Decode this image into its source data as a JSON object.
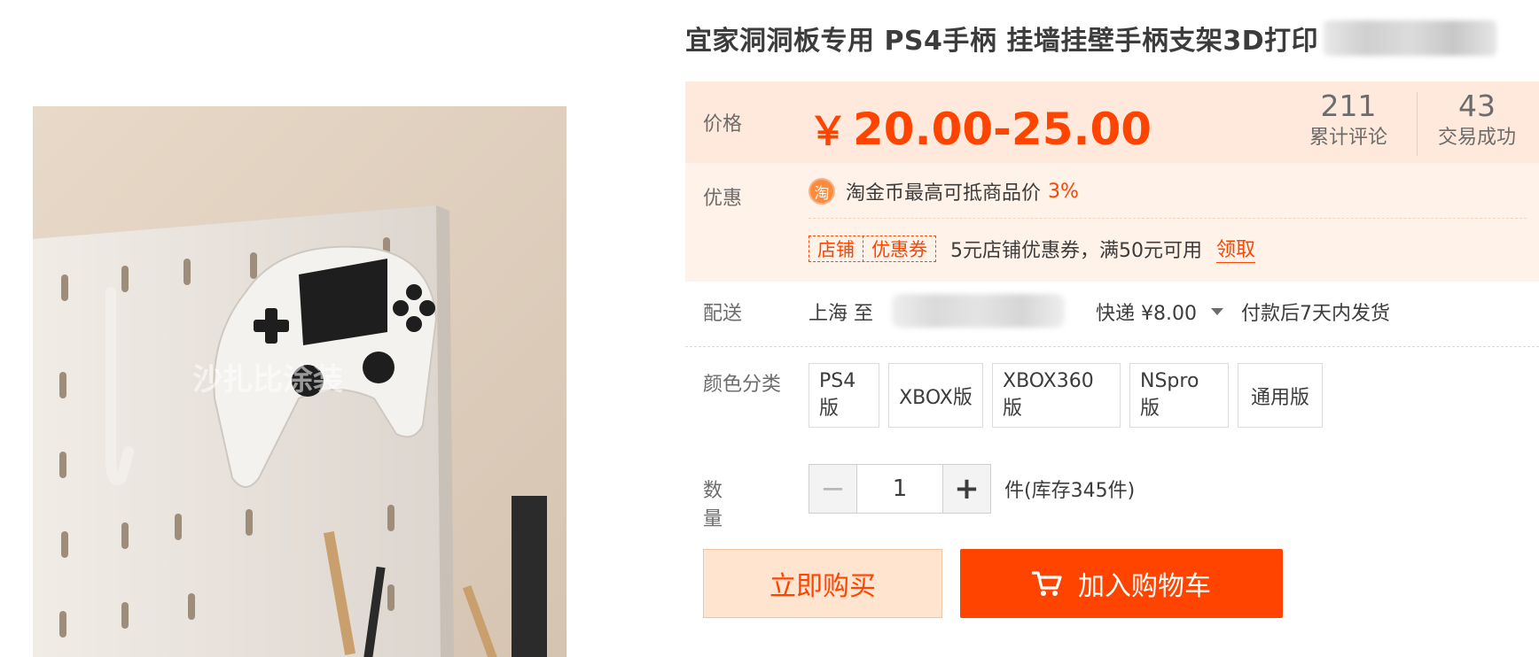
{
  "colors": {
    "accent": "#ff4400",
    "promo_bg": "#fff2e8",
    "price_bg": "#ffe9dc"
  },
  "product": {
    "title": "宜家洞洞板专用 PS4手柄 挂墙挂壁手柄支架3D打印",
    "image_alt": "PS4 controller mounted on pegboard"
  },
  "price": {
    "label": "价格",
    "currency": "￥",
    "range": "20.00-25.00"
  },
  "stats": {
    "reviews": {
      "value": "211",
      "label": "累计评论"
    },
    "deals": {
      "value": "43",
      "label": "交易成功"
    }
  },
  "promo": {
    "label": "优惠",
    "coin_icon": "淘",
    "coin_text": "淘金币最高可抵商品价",
    "coin_pct": "3%",
    "coupon_tag_left": "店铺",
    "coupon_tag_right": "优惠券",
    "coupon_text": "5元店铺优惠券，满50元可用",
    "coupon_link": "领取"
  },
  "shipping": {
    "label": "配送",
    "from": "上海 至",
    "method": "快递 ¥8.00",
    "time": "付款后7天内发货"
  },
  "variants": {
    "label": "颜色分类",
    "options": [
      "PS4版",
      "XBOX版",
      "XBOX360版",
      "NSpro版",
      "通用版"
    ]
  },
  "quantity": {
    "label": "数量",
    "value": "1",
    "minus": "−",
    "plus": "+",
    "stock": "件(库存345件)"
  },
  "actions": {
    "buy_now": "立即购买",
    "add_to_cart": "加入购物车"
  }
}
